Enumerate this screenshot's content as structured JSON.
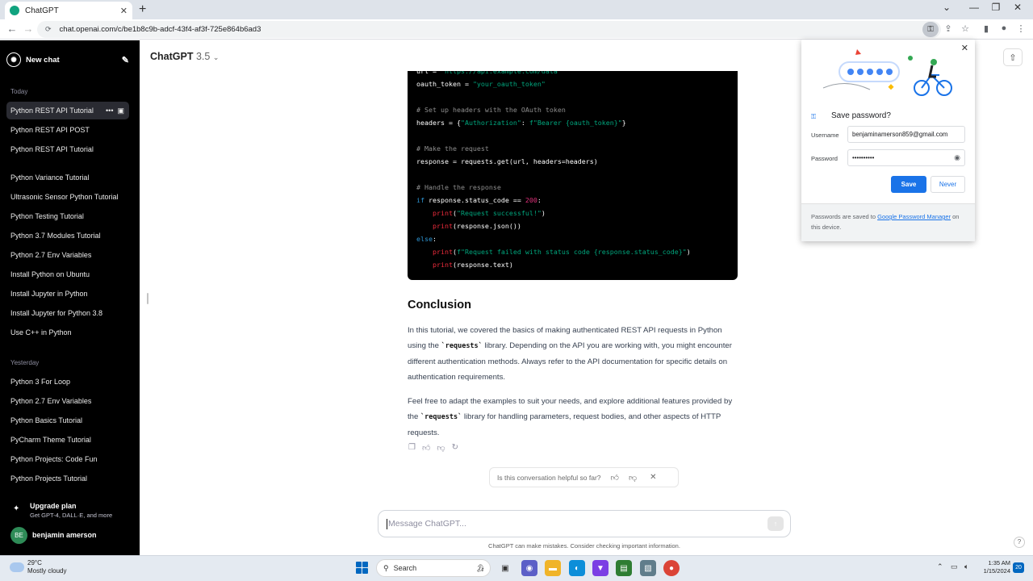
{
  "browser": {
    "tab_title": "ChatGPT",
    "url": "chat.openai.com/c/be1b8c9b-adcf-43f4-af3f-725e864b6ad3"
  },
  "sidebar": {
    "new_chat": "New chat",
    "today_label": "Today",
    "today": [
      "Python REST API Tutorial",
      "Python REST API POST",
      "Python REST API Tutorial",
      "Python Variance Tutorial",
      "Ultrasonic Sensor Python Tutorial",
      "Python Testing Tutorial",
      "Python 3.7 Modules Tutorial",
      "Python 2.7 Env Variables",
      "Install Python on Ubuntu",
      "Install Jupyter in Python",
      "Install Jupyter for Python 3.8",
      "Use C++ in Python"
    ],
    "yesterday_label": "Yesterday",
    "yesterday": [
      "Python 3 For Loop",
      "Python 2.7 Env Variables",
      "Python Basics Tutorial",
      "PyCharm Theme Tutorial",
      "Python Projects: Code Fun",
      "Python Projects Tutorial"
    ],
    "upgrade_title": "Upgrade plan",
    "upgrade_sub": "Get GPT-4, DALL·E, and more",
    "user_initials": "BE",
    "user_name": "benjamin amerson"
  },
  "header": {
    "model": "ChatGPT",
    "version": "3.5"
  },
  "code_lines": [
    [
      {
        "t": "url = ",
        "c": ""
      },
      {
        "t": "\"https://api.example.com/data\"",
        "c": "s"
      }
    ],
    [
      {
        "t": "oauth_token = ",
        "c": ""
      },
      {
        "t": "\"your_oauth_token\"",
        "c": "s"
      }
    ],
    [],
    [
      {
        "t": "# Set up headers with the OAuth token",
        "c": "c"
      }
    ],
    [
      {
        "t": "headers = {",
        "c": ""
      },
      {
        "t": "\"Authorization\"",
        "c": "s"
      },
      {
        "t": ": ",
        "c": ""
      },
      {
        "t": "f\"Bearer {oauth_token}\"",
        "c": "s"
      },
      {
        "t": "}",
        "c": ""
      }
    ],
    [],
    [
      {
        "t": "# Make the request",
        "c": "c"
      }
    ],
    [
      {
        "t": "response = requests.get(url, headers=headers)",
        "c": ""
      }
    ],
    [],
    [
      {
        "t": "# Handle the response",
        "c": "c"
      }
    ],
    [
      {
        "t": "if",
        "c": "k"
      },
      {
        "t": " response.status_code == ",
        "c": ""
      },
      {
        "t": "200",
        "c": "n"
      },
      {
        "t": ":",
        "c": ""
      }
    ],
    [
      {
        "t": "    ",
        "c": ""
      },
      {
        "t": "print",
        "c": "f"
      },
      {
        "t": "(",
        "c": ""
      },
      {
        "t": "\"Request successful!\"",
        "c": "s"
      },
      {
        "t": ")",
        "c": ""
      }
    ],
    [
      {
        "t": "    ",
        "c": ""
      },
      {
        "t": "print",
        "c": "f"
      },
      {
        "t": "(response.json())",
        "c": ""
      }
    ],
    [
      {
        "t": "else",
        "c": "k"
      },
      {
        "t": ":",
        "c": ""
      }
    ],
    [
      {
        "t": "    ",
        "c": ""
      },
      {
        "t": "print",
        "c": "f"
      },
      {
        "t": "(",
        "c": ""
      },
      {
        "t": "f\"Request failed with status code {response.status_code}\"",
        "c": "s"
      },
      {
        "t": ")",
        "c": ""
      }
    ],
    [
      {
        "t": "    ",
        "c": ""
      },
      {
        "t": "print",
        "c": "f"
      },
      {
        "t": "(response.text)",
        "c": ""
      }
    ]
  ],
  "content": {
    "heading": "Conclusion",
    "p1_a": "In this tutorial, we covered the basics of making authenticated REST API requests in Python using the ",
    "p1_code": "`requests`",
    "p1_b": " library. Depending on the API you are working with, you might encounter different authentication methods. Always refer to the API documentation for specific details on authentication requirements.",
    "p2_a": "Feel free to adapt the examples to suit your needs, and explore additional features provided by the ",
    "p2_code": "`requests`",
    "p2_b": " library for handling parameters, request bodies, and other aspects of HTTP requests."
  },
  "feedback": {
    "question": "Is this conversation helpful so far?"
  },
  "composer": {
    "placeholder": "Message ChatGPT...",
    "disclaimer": "ChatGPT can make mistakes. Consider checking important information."
  },
  "password_popup": {
    "title": "Save password?",
    "username_label": "Username",
    "username_value": "benjaminamerson859@gmail.com",
    "password_label": "Password",
    "password_value": "••••••••••",
    "save": "Save",
    "never": "Never",
    "footer_a": "Passwords are saved to ",
    "footer_link": "Google Password Manager",
    "footer_b": " on this device."
  },
  "taskbar": {
    "temp": "29°C",
    "condition": "Mostly cloudy",
    "search": "Search",
    "time": "1:35 AM",
    "date": "1/15/2024",
    "notifications": "20"
  },
  "colors": {
    "sidebar_bg": "#000000",
    "accent_blue": "#1a73e8",
    "code_string": "#00a67d",
    "code_keyword": "#2e95d3",
    "code_number": "#df3079"
  }
}
